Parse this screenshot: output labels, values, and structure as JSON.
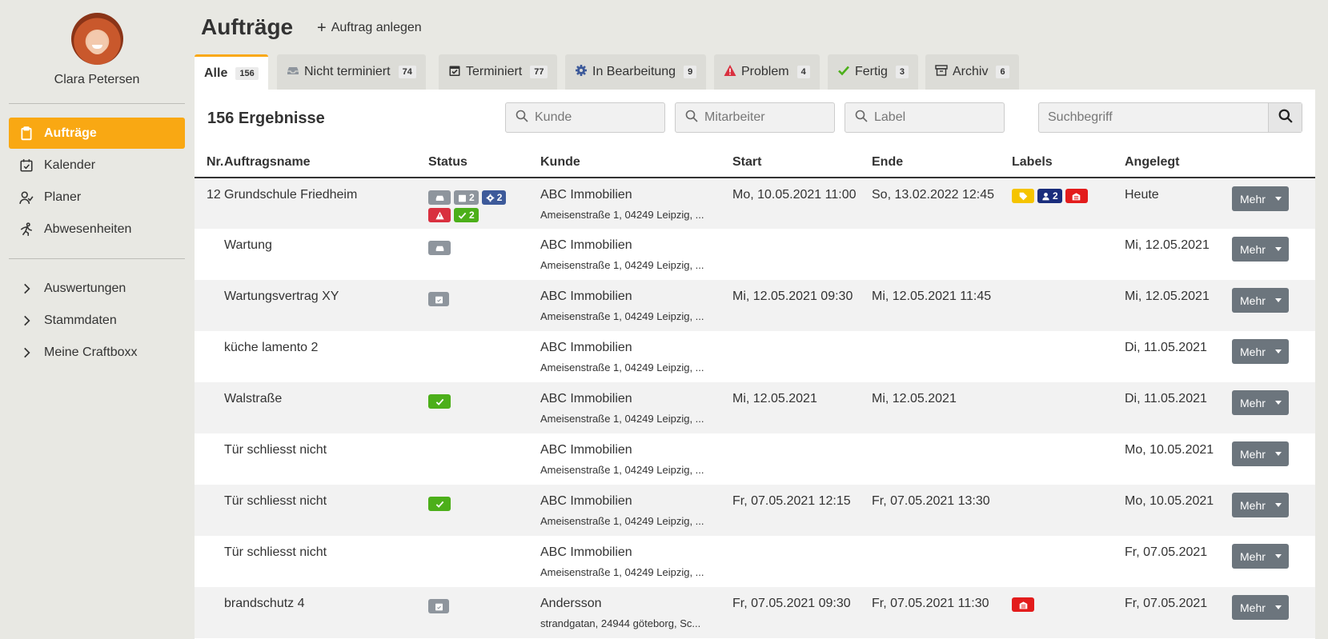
{
  "user": {
    "name": "Clara Petersen"
  },
  "sidebar": {
    "items": [
      {
        "label": "Aufträge",
        "icon": "clipboard-icon"
      },
      {
        "label": "Kalender",
        "icon": "calendar-check-icon"
      },
      {
        "label": "Planer",
        "icon": "user-check-icon"
      },
      {
        "label": "Abwesenheiten",
        "icon": "running-person-icon"
      }
    ],
    "groups": [
      {
        "label": "Auswertungen"
      },
      {
        "label": "Stammdaten"
      },
      {
        "label": "Meine Craftboxx"
      }
    ]
  },
  "header": {
    "title": "Aufträge",
    "add_label": "Auftrag anlegen"
  },
  "tabs": [
    {
      "label": "Alle",
      "count": "156"
    },
    {
      "label": "Nicht terminiert",
      "count": "74"
    },
    {
      "label": "Terminiert",
      "count": "77"
    },
    {
      "label": "In Bearbeitung",
      "count": "9"
    },
    {
      "label": "Problem",
      "count": "4"
    },
    {
      "label": "Fertig",
      "count": "3"
    },
    {
      "label": "Archiv",
      "count": "6"
    }
  ],
  "results_label": "156 Ergebnisse",
  "filters": {
    "kunde": "Kunde",
    "mitarbeiter": "Mitarbeiter",
    "label": "Label",
    "search_placeholder": "Suchbegriff"
  },
  "table": {
    "columns": [
      "Nr.",
      "Auftragsname",
      "Status",
      "Kunde",
      "Start",
      "Ende",
      "Labels",
      "Angelegt"
    ],
    "more_label": "Mehr",
    "rows": [
      {
        "nr": "12",
        "name": "Grundschule Friedheim",
        "kunde": "ABC Immobilien",
        "addr": "Ameisenstraße 1, 04249 Leipzig, ...",
        "start": "Mo, 10.05.2021 11:00",
        "end": "So, 13.02.2022 12:45",
        "created": "Heute",
        "status_counts": {
          "terminiert": "2",
          "bearbeitung": "2",
          "fertig": "2"
        }
      },
      {
        "nr": "",
        "name": "Wartung",
        "kunde": "ABC Immobilien",
        "addr": "Ameisenstraße 1, 04249 Leipzig, ...",
        "start": "",
        "end": "",
        "created": "Mi, 12.05.2021"
      },
      {
        "nr": "",
        "name": "Wartungsvertrag XY",
        "kunde": "ABC Immobilien",
        "addr": "Ameisenstraße 1, 04249 Leipzig, ...",
        "start": "Mi, 12.05.2021 09:30",
        "end": "Mi, 12.05.2021 11:45",
        "created": "Mi, 12.05.2021"
      },
      {
        "nr": "",
        "name": "küche lamento 2",
        "kunde": "ABC Immobilien",
        "addr": "Ameisenstraße 1, 04249 Leipzig, ...",
        "start": "",
        "end": "",
        "created": "Di, 11.05.2021"
      },
      {
        "nr": "",
        "name": "Walstraße",
        "kunde": "ABC Immobilien",
        "addr": "Ameisenstraße 1, 04249 Leipzig, ...",
        "start": "Mi, 12.05.2021",
        "end": "Mi, 12.05.2021",
        "created": "Di, 11.05.2021"
      },
      {
        "nr": "",
        "name": "Tür schliesst nicht",
        "kunde": "ABC Immobilien",
        "addr": "Ameisenstraße 1, 04249 Leipzig, ...",
        "start": "",
        "end": "",
        "created": "Mo, 10.05.2021"
      },
      {
        "nr": "",
        "name": "Tür schliesst nicht",
        "kunde": "ABC Immobilien",
        "addr": "Ameisenstraße 1, 04249 Leipzig, ...",
        "start": "Fr, 07.05.2021 12:15",
        "end": "Fr, 07.05.2021 13:30",
        "created": "Mo, 10.05.2021"
      },
      {
        "nr": "",
        "name": "Tür schliesst nicht",
        "kunde": "ABC Immobilien",
        "addr": "Ameisenstraße 1, 04249 Leipzig, ...",
        "start": "",
        "end": "",
        "created": "Fr, 07.05.2021"
      },
      {
        "nr": "",
        "name": "brandschutz 4",
        "kunde": "Andersson",
        "addr": "strandgatan, 24944 göteborg, Sc...",
        "start": "Fr, 07.05.2021 09:30",
        "end": "Fr, 07.05.2021 11:30",
        "created": "Fr, 07.05.2021"
      }
    ],
    "row0_labels": {
      "person_count": "2"
    }
  },
  "colors": {
    "accent": "#f9a813",
    "button": "#6c757d"
  }
}
